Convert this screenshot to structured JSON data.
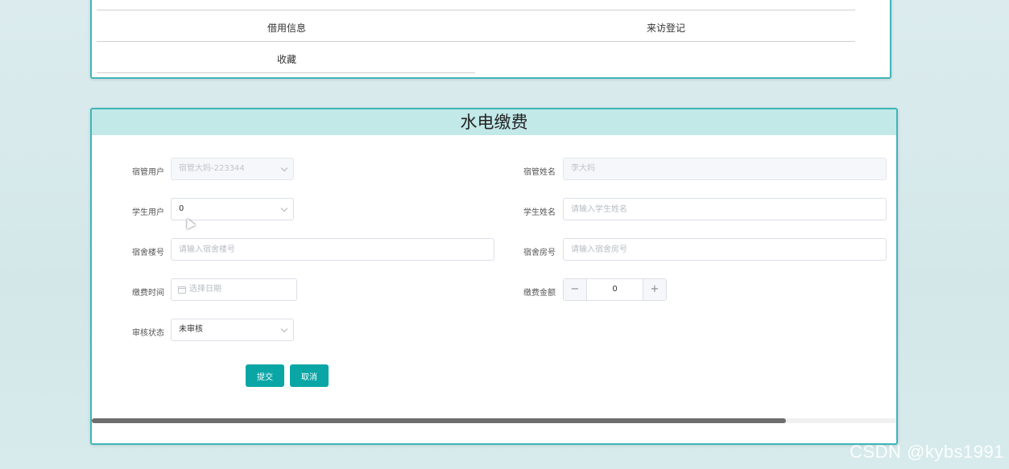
{
  "top_menu": {
    "items": [
      "借用信息",
      "来访登记",
      "收藏"
    ]
  },
  "form": {
    "title": "水电缴费",
    "fields": {
      "manager_user": {
        "label": "宿管用户",
        "value": "宿管大妈-223344"
      },
      "manager_name": {
        "label": "宿管姓名",
        "value": "李大妈"
      },
      "student_user": {
        "label": "学生用户",
        "value": "0"
      },
      "student_name": {
        "label": "学生姓名",
        "placeholder": "请输入学生姓名"
      },
      "dorm_building": {
        "label": "宿舍楼号",
        "placeholder": "请输入宿舍楼号"
      },
      "dorm_room": {
        "label": "宿舍房号",
        "placeholder": "请输入宿舍房号"
      },
      "pay_time": {
        "label": "缴费时间",
        "placeholder": "选择日期"
      },
      "pay_amount": {
        "label": "缴费金额",
        "value": "0",
        "minus": "−",
        "plus": "+"
      },
      "review_status": {
        "label": "审核状态",
        "value": "未审核"
      }
    },
    "buttons": {
      "submit": "提交",
      "cancel": "取消"
    }
  },
  "watermark": "CSDN @kybs1991",
  "colors": {
    "accent": "#0aa6a6",
    "border": "#3fb5b8",
    "header": "#c2e8e8"
  }
}
